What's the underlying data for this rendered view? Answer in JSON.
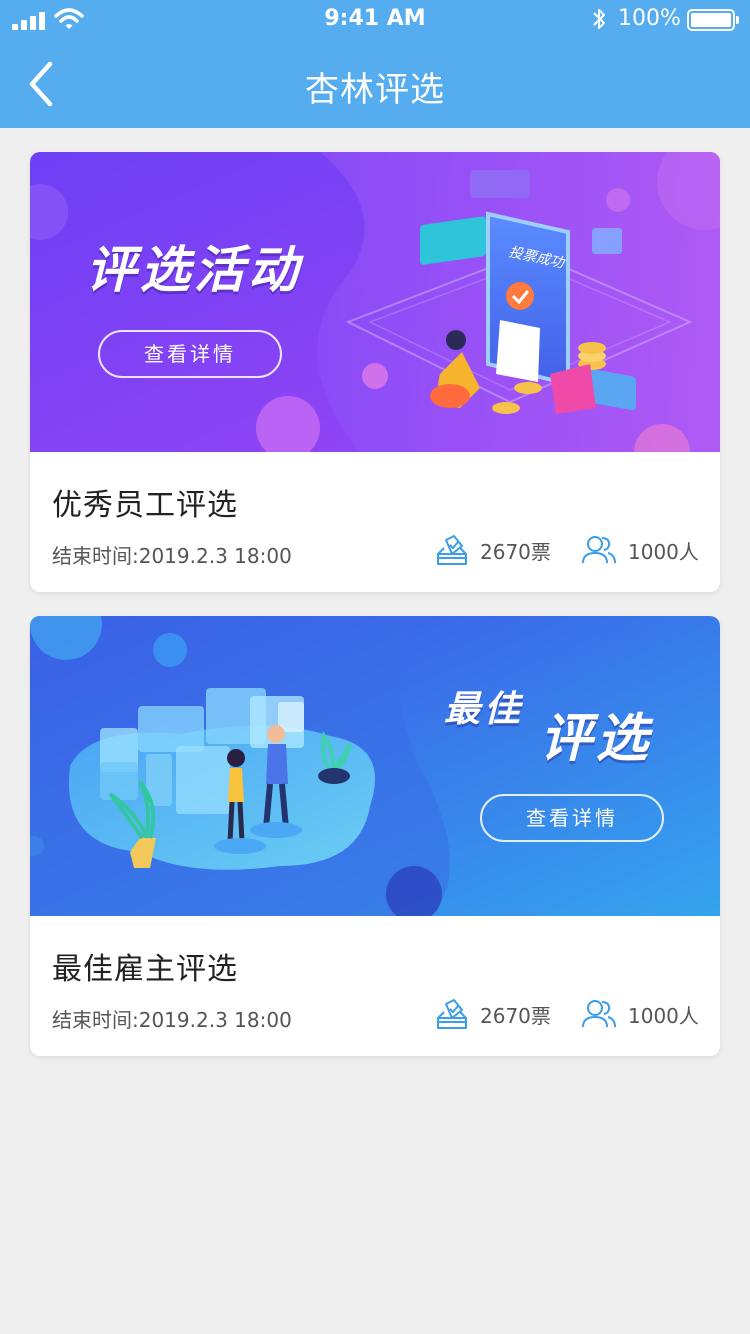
{
  "status_bar": {
    "time": "9:41 AM",
    "battery": "100%"
  },
  "nav": {
    "title": "杏林评选"
  },
  "cards": [
    {
      "banner_title": "评选活动",
      "banner_button": "查看详情",
      "banner_badge": "投票成功",
      "title": "优秀员工评选",
      "end_time": "结束时间:2019.2.3   18:00",
      "votes": "2670票",
      "people": "1000人",
      "colors": {
        "start": "#6c3ff5",
        "end": "#a24cf6"
      }
    },
    {
      "banner_title_1": "最佳",
      "banner_title_2": "评选",
      "banner_button": "查看详情",
      "title": "最佳雇主评选",
      "end_time": "结束时间:2019.2.3   18:00",
      "votes": "2670票",
      "people": "1000人",
      "colors": {
        "start": "#3a57e6",
        "end": "#35a0ec"
      }
    }
  ],
  "icons": [
    "signal-icon",
    "wifi-icon",
    "bluetooth-icon",
    "battery-icon",
    "back-icon",
    "ballot-icon",
    "people-icon"
  ],
  "colors": {
    "header": "#55acef",
    "accent_icon": "#3a9ee8",
    "background": "#efefef"
  }
}
